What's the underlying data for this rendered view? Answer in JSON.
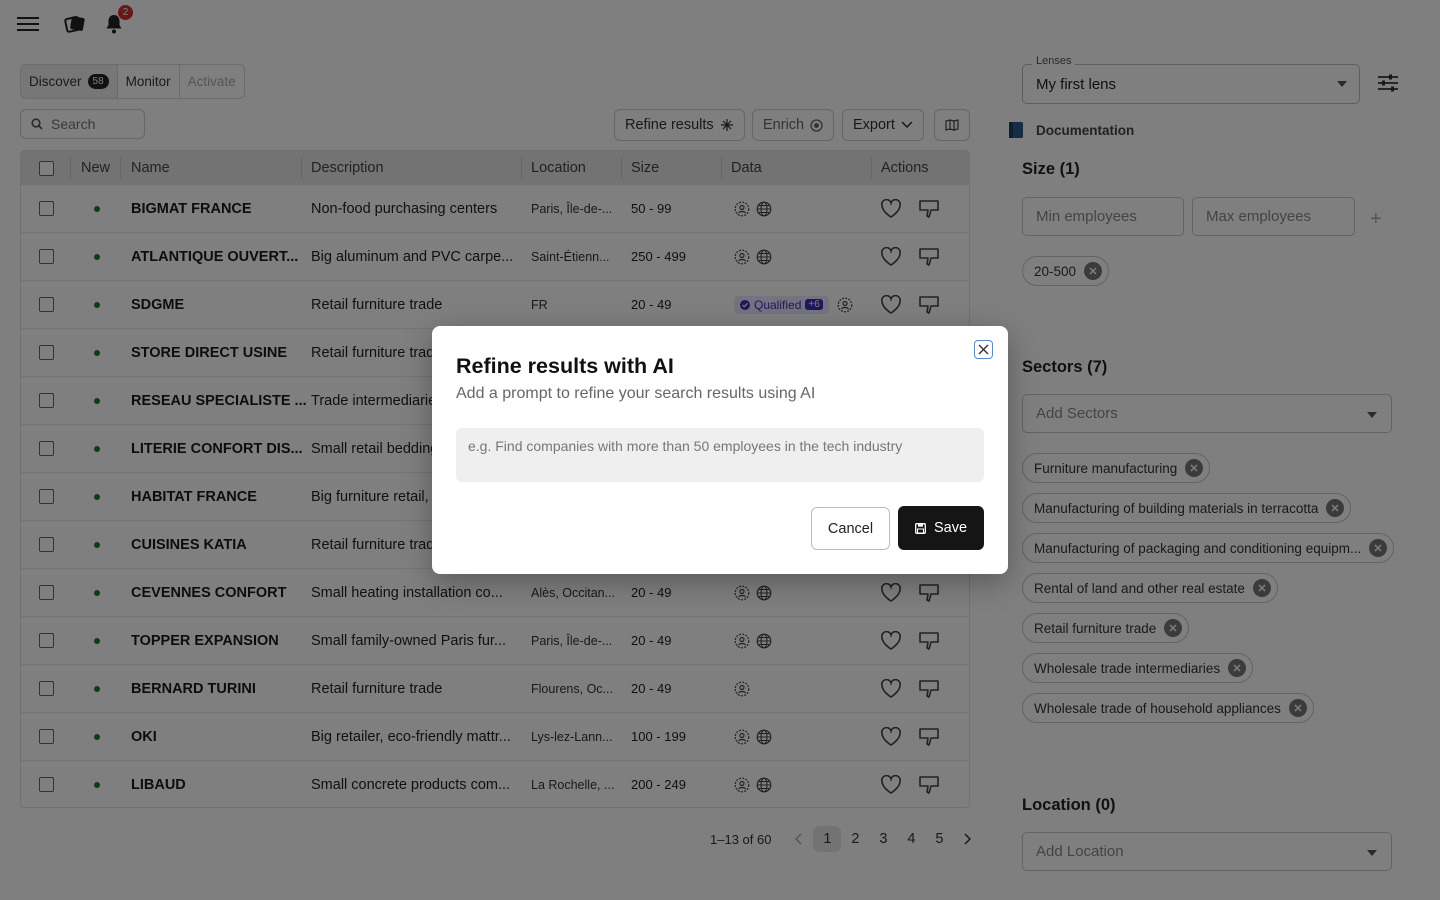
{
  "topbar": {
    "notification_count": "2"
  },
  "tabs": [
    {
      "label": "Discover",
      "count": "58"
    },
    {
      "label": "Monitor"
    },
    {
      "label": "Activate"
    }
  ],
  "search": {
    "placeholder": "Search"
  },
  "toolbar": {
    "refine_label": "Refine results",
    "enrich_label": "Enrich",
    "export_label": "Export"
  },
  "table": {
    "headers": {
      "new": "New",
      "name": "Name",
      "description": "Description",
      "location": "Location",
      "size": "Size",
      "data": "Data",
      "actions": "Actions"
    },
    "rows": [
      {
        "name": "BIGMAT FRANCE",
        "description": "Non-food purchasing centers",
        "location": "Paris, Île-de-...",
        "size": "50 - 99",
        "data": [
          "person-icon",
          "globe-icon"
        ]
      },
      {
        "name": "ATLANTIQUE OUVERT...",
        "description": "Big aluminum and PVC carpe...",
        "location": "Saint-Étienn...",
        "size": "250 - 499",
        "data": [
          "person-icon",
          "globe-icon"
        ]
      },
      {
        "name": "SDGME",
        "description": "Retail furniture trade",
        "location": "FR",
        "size": "20 - 49",
        "qualified": {
          "label": "Qualified",
          "extra": "+6"
        },
        "data": [
          "person-icon"
        ]
      },
      {
        "name": "STORE DIRECT USINE",
        "description": "Retail furniture trade",
        "location": "",
        "size": "",
        "data": []
      },
      {
        "name": "RESEAU SPECIALISTE ...",
        "description": "Trade intermediaries",
        "location": "",
        "size": "",
        "data": []
      },
      {
        "name": "LITERIE CONFORT DIS...",
        "description": "Small retail bedding",
        "location": "",
        "size": "",
        "data": []
      },
      {
        "name": "HABITAT FRANCE",
        "description": "Big furniture retail,",
        "location": "",
        "size": "",
        "data": []
      },
      {
        "name": "CUISINES KATIA",
        "description": "Retail furniture trade",
        "location": "",
        "size": "",
        "data": []
      },
      {
        "name": "CEVENNES CONFORT",
        "description": "Small heating installation co...",
        "location": "Alès, Occitan...",
        "size": "20 - 49",
        "data": [
          "person-icon",
          "globe-icon"
        ]
      },
      {
        "name": "TOPPER EXPANSION",
        "description": "Small family-owned Paris fur...",
        "location": "Paris, Île-de-...",
        "size": "20 - 49",
        "data": [
          "person-icon",
          "globe-icon"
        ]
      },
      {
        "name": "BERNARD TURINI",
        "description": "Retail furniture trade",
        "location": "Flourens, Oc...",
        "size": "20 - 49",
        "data": [
          "person-icon"
        ]
      },
      {
        "name": "OKI",
        "description": "Big retailer, eco-friendly mattr...",
        "location": "Lys-lez-Lann...",
        "size": "100 - 199",
        "data": [
          "person-icon",
          "globe-icon"
        ]
      },
      {
        "name": "LIBAUD",
        "description": "Small concrete products com...",
        "location": "La Rochelle, ...",
        "size": "200 - 249",
        "data": [
          "person-icon",
          "globe-icon"
        ]
      }
    ]
  },
  "pagination": {
    "summary": "1–13 of 60",
    "pages": [
      "1",
      "2",
      "3",
      "4",
      "5"
    ],
    "current": "1"
  },
  "filters": {
    "lenses_label": "Lenses",
    "lens_value": "My first lens",
    "documentation": "Documentation",
    "size": {
      "title": "Size (1)",
      "min_placeholder": "Min employees",
      "max_placeholder": "Max employees",
      "chips": [
        "20-500"
      ]
    },
    "sectors": {
      "title": "Sectors (7)",
      "placeholder": "Add Sectors",
      "chips": [
        "Furniture manufacturing",
        "Manufacturing of building materials in terracotta",
        "Manufacturing of packaging and conditioning equipm...",
        "Rental of land and other real estate",
        "Retail furniture trade",
        "Wholesale trade intermediaries",
        "Wholesale trade of household appliances"
      ]
    },
    "location": {
      "title": "Location (0)",
      "placeholder": "Add Location"
    }
  },
  "modal": {
    "title": "Refine results with AI",
    "subtitle": "Add a prompt to refine your search results using AI",
    "placeholder": "e.g. Find companies with more than 50 employees in the tech industry",
    "cancel_label": "Cancel",
    "save_label": "Save"
  },
  "colors": {
    "accent_dark": "#151515",
    "new_dot": "#1a7a2e",
    "qualified_bg": "#e8e6ff",
    "qualified_fg": "#3b32b5",
    "badge": "#d32f2f"
  }
}
